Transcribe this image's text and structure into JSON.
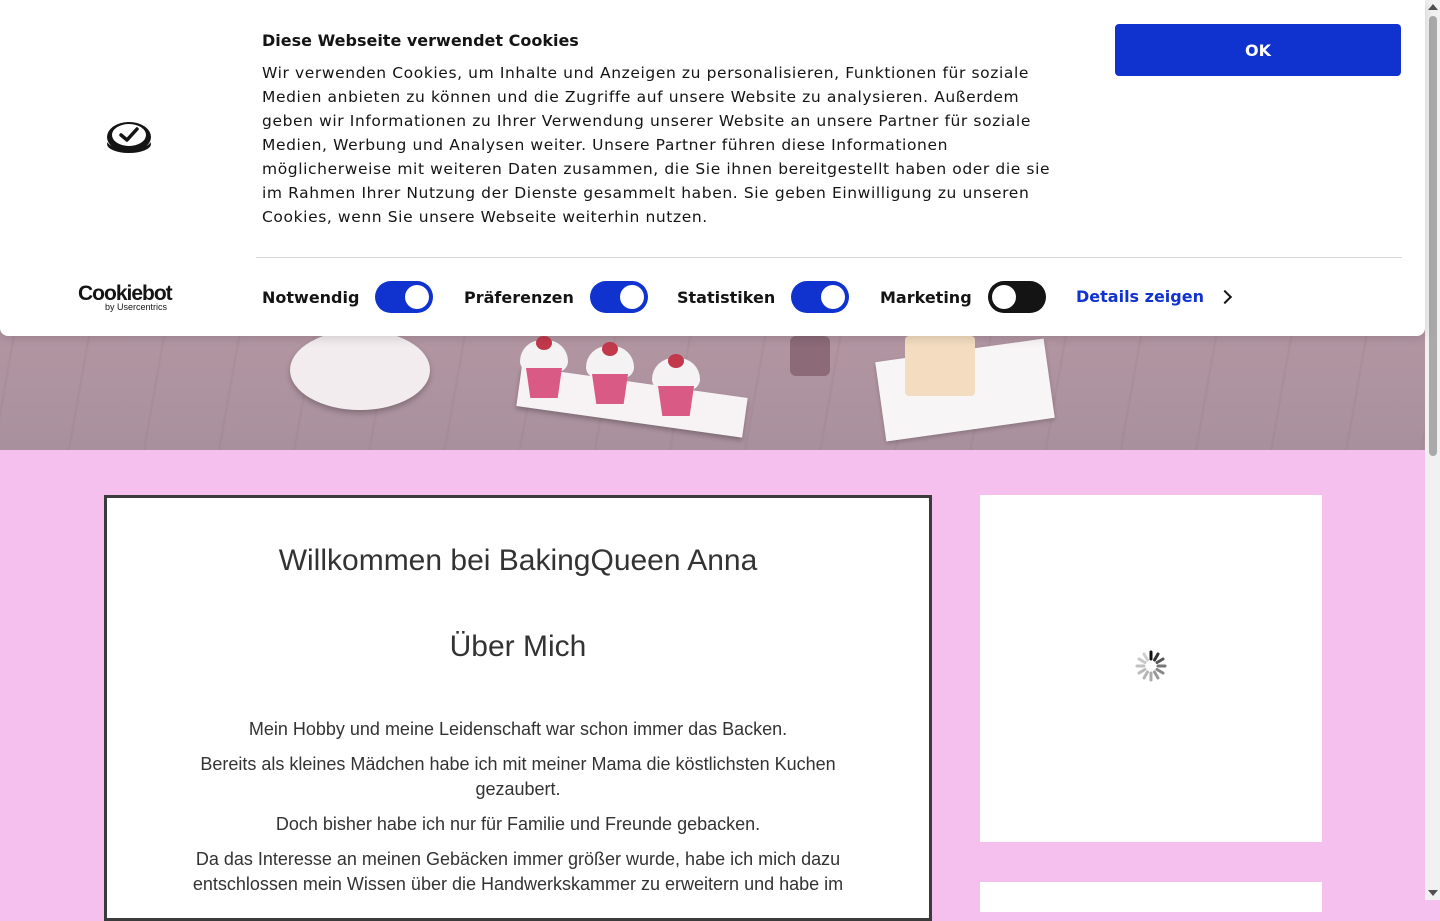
{
  "cookie_banner": {
    "title": "Diese Webseite verwendet Cookies",
    "text": "Wir verwenden Cookies, um Inhalte und Anzeigen zu personalisieren, Funktionen für soziale Medien anbieten zu können und die Zugriffe auf unsere Website zu analysieren. Außerdem geben wir Informationen zu Ihrer Verwendung unserer Website an unsere Partner für soziale Medien, Werbung und Analysen weiter. Unsere Partner führen diese Informationen möglicherweise mit weiteren Daten zusammen, die Sie ihnen bereitgestellt haben oder die sie im Rahmen Ihrer Nutzung der Dienste gesammelt haben. Sie geben Einwilligung zu unseren Cookies, wenn Sie unsere Webseite weiterhin nutzen.",
    "ok_label": "OK",
    "brand": "Cookiebot",
    "brand_sub": "by Usercentrics",
    "options": [
      {
        "label": "Notwendig",
        "checked": true
      },
      {
        "label": "Präferenzen",
        "checked": true
      },
      {
        "label": "Statistiken",
        "checked": true
      },
      {
        "label": "Marketing",
        "checked": false
      }
    ],
    "details_label": "Details zeigen",
    "accent_color": "#1032cf"
  },
  "main": {
    "welcome": "Willkommen bei BakingQueen Anna",
    "about_heading": "Über Mich",
    "paragraphs": [
      "Mein Hobby und meine Leidenschaft war schon immer das Backen.",
      "Bereits als kleines Mädchen habe ich mit meiner Mama die köstlichsten Kuchen gezaubert.",
      "Doch bisher habe ich nur für Familie und Freunde gebacken.",
      "Da das Interesse an meinen Gebäcken immer größer wurde, habe ich mich dazu entschlossen mein Wissen über die Handwerkskammer zu erweitern und habe im"
    ],
    "background_color": "#f5c0ee"
  }
}
